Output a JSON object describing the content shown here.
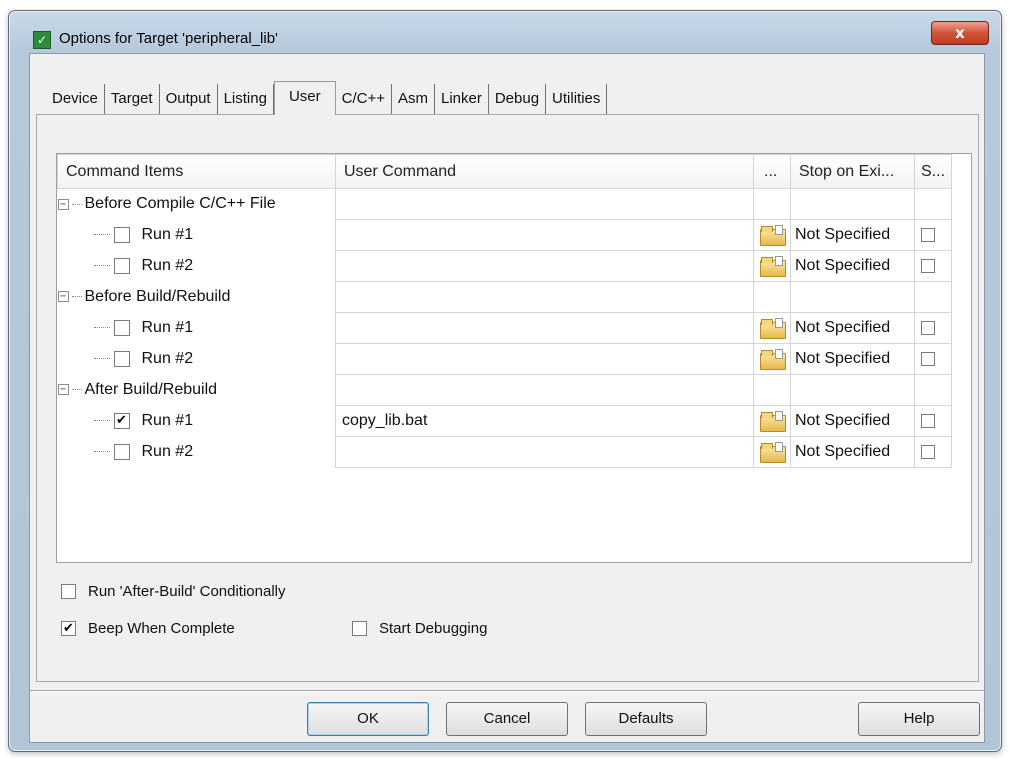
{
  "window": {
    "title": "Options for Target 'peripheral_lib'",
    "close_glyph": "x"
  },
  "tabs": [
    {
      "label": "Device"
    },
    {
      "label": "Target"
    },
    {
      "label": "Output"
    },
    {
      "label": "Listing"
    },
    {
      "label": "User",
      "active": true
    },
    {
      "label": "C/C++"
    },
    {
      "label": "Asm"
    },
    {
      "label": "Linker"
    },
    {
      "label": "Debug"
    },
    {
      "label": "Utilities"
    }
  ],
  "grid": {
    "columns": {
      "items": "Command Items",
      "command": "User Command",
      "browse": "...",
      "stop": "Stop on Exi...",
      "s": "S..."
    },
    "groups": [
      {
        "label": "Before Compile C/C++ File",
        "rows": [
          {
            "label": "Run #1",
            "checked": false,
            "command": "",
            "stop": "Not Specified",
            "s_checked": false
          },
          {
            "label": "Run #2",
            "checked": false,
            "command": "",
            "stop": "Not Specified",
            "s_checked": false
          }
        ]
      },
      {
        "label": "Before Build/Rebuild",
        "rows": [
          {
            "label": "Run #1",
            "checked": false,
            "command": "",
            "stop": "Not Specified",
            "s_checked": false
          },
          {
            "label": "Run #2",
            "checked": false,
            "command": "",
            "stop": "Not Specified",
            "s_checked": false
          }
        ]
      },
      {
        "label": "After Build/Rebuild",
        "rows": [
          {
            "label": "Run #1",
            "checked": true,
            "command": "copy_lib.bat",
            "stop": "Not Specified",
            "s_checked": false
          },
          {
            "label": "Run #2",
            "checked": false,
            "command": "",
            "stop": "Not Specified",
            "s_checked": false
          }
        ]
      }
    ]
  },
  "options": {
    "run_after_build": {
      "label": "Run 'After-Build' Conditionally",
      "checked": false
    },
    "beep": {
      "label": "Beep When Complete",
      "checked": true
    },
    "start_debugging": {
      "label": "Start Debugging",
      "checked": false
    }
  },
  "buttons": {
    "ok": "OK",
    "cancel": "Cancel",
    "defaults": "Defaults",
    "help": "Help"
  },
  "icons": {
    "collapse_glyph": "−",
    "check_glyph": "✔"
  }
}
